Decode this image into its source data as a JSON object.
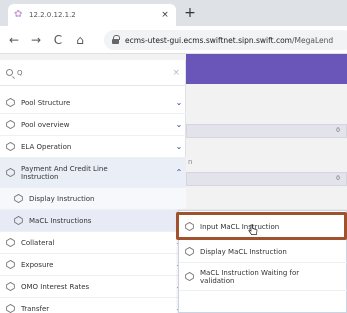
{
  "browser": {
    "tab_title": "12.2.0.12.1.2",
    "tab_close": "×",
    "new_tab": "+",
    "back": "←",
    "forward": "→",
    "reload": "C",
    "home": "⌂",
    "url_host": "ecms-utest-gui.ecms.swiftnet.sipn.swift.com",
    "url_path": "/MegaLend"
  },
  "sidebar": {
    "search_placeholder": "Q",
    "search_clear": "×",
    "items": [
      {
        "label": "Pool Structure",
        "chevron": "⌄"
      },
      {
        "label": "Pool overview",
        "chevron": "⌄"
      },
      {
        "label": "ELA Operation",
        "chevron": "⌄"
      },
      {
        "label": "Payment And Credit Line Instruction",
        "chevron": "⌃"
      },
      {
        "label": "Display Instruction",
        "chevron": ""
      },
      {
        "label": "MaCL Instructions",
        "chevron": "‹"
      },
      {
        "label": "Collateral",
        "chevron": "⌄"
      },
      {
        "label": "Exposure",
        "chevron": "⌄"
      },
      {
        "label": "OMO Interest Rates",
        "chevron": "⌄"
      },
      {
        "label": "Transfer",
        "chevron": "⌄"
      }
    ]
  },
  "flyout": {
    "items": [
      {
        "label": "Input MaCL Instruction"
      },
      {
        "label": "Display MaCL Instruction"
      },
      {
        "label": "MaCL Instruction Waiting for validation"
      }
    ]
  },
  "content": {
    "value_1": "0",
    "value_2": "0",
    "label_n": "n"
  },
  "colors": {
    "accent_purple": "#6a55b8",
    "chevron_blue": "#2c3f8f",
    "highlight_brown": "#a0522d"
  }
}
